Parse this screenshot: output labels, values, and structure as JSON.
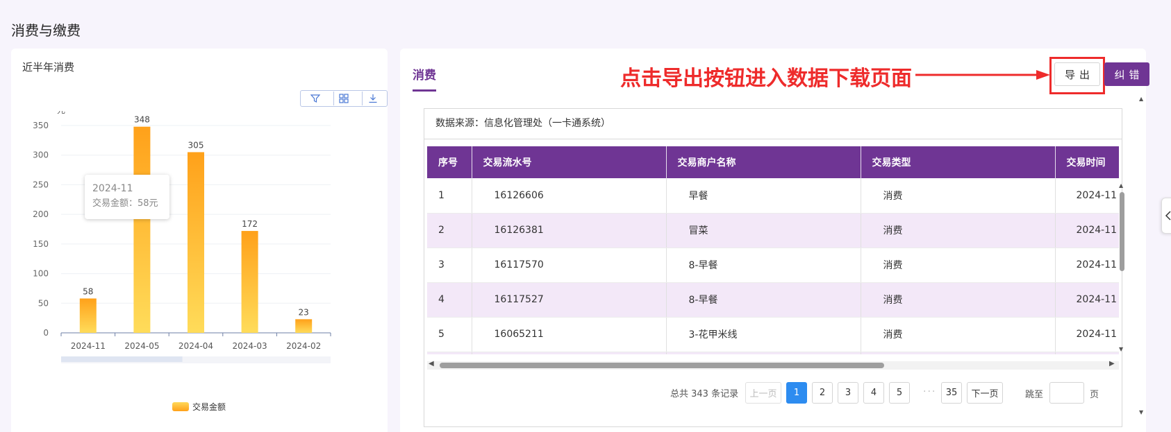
{
  "page": {
    "title": "消费与缴费"
  },
  "left_card": {
    "title": "近半年消费",
    "toolbar": [
      {
        "icon": "filter-icon"
      },
      {
        "icon": "grid-icon"
      },
      {
        "icon": "download-icon"
      }
    ],
    "tooltip": {
      "title": "2024-11",
      "text": "交易金额：58元"
    },
    "legend": "交易金额"
  },
  "chart_data": {
    "type": "bar",
    "categories": [
      "2024-11",
      "2024-05",
      "2024-04",
      "2024-03",
      "2024-02"
    ],
    "series": [
      {
        "name": "交易金额",
        "values": [
          58,
          348,
          305,
          172,
          23
        ]
      }
    ],
    "ylabel": "元",
    "ylim": [
      0,
      350
    ],
    "yticks": [
      0,
      50,
      100,
      150,
      200,
      250,
      300,
      350
    ],
    "colors": {
      "top": "#ffa11a",
      "bottom": "#ffdc5a"
    },
    "grid": true,
    "legend_position": "bottom-center"
  },
  "right_card": {
    "tab": "消费",
    "annotation": "点击导出按钮进入数据下载页面",
    "export_label": "导出",
    "correct_label": "纠错",
    "source": "数据来源：信息化管理处（一卡通系统）",
    "columns": [
      "序号",
      "交易流水号",
      "交易商户名称",
      "交易类型",
      "交易时间"
    ],
    "rows": [
      [
        "1",
        "16126606",
        "早餐",
        "消费",
        "2024-11"
      ],
      [
        "2",
        "16126381",
        "冒菜",
        "消费",
        "2024-11"
      ],
      [
        "3",
        "16117570",
        "8-早餐",
        "消费",
        "2024-11"
      ],
      [
        "4",
        "16117527",
        "8-早餐",
        "消费",
        "2024-11"
      ],
      [
        "5",
        "16065211",
        "3-花甲米线",
        "消费",
        "2024-11"
      ]
    ],
    "pagination": {
      "total": "总共 343 条记录",
      "prev": "上一页",
      "pages": [
        "1",
        "2",
        "3",
        "4",
        "5"
      ],
      "ellipsis": "···",
      "last": "35",
      "next": "下一页",
      "jump": "跳至",
      "unit": "页",
      "current": "1"
    }
  },
  "accent": "#6f3594",
  "highlight": "#ee2b2b"
}
